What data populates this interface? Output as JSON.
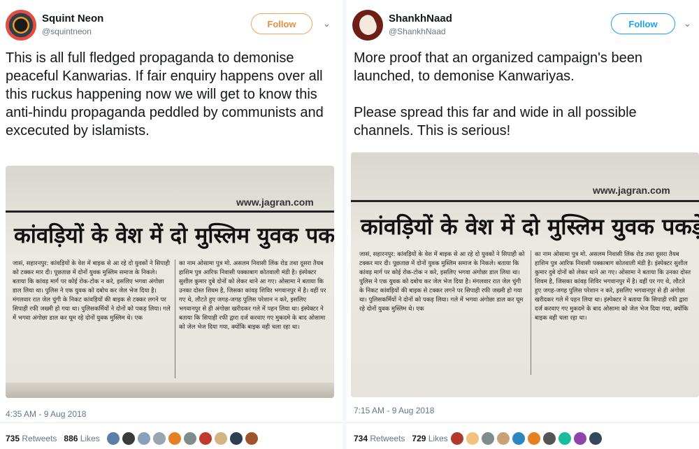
{
  "tweets": [
    {
      "name": "Squint Neon",
      "handle": "@squintneon",
      "follow_label": "Follow",
      "chevron": "⌄",
      "text": "This is all full fledged propaganda to demonise peaceful Kanwarias. If fair enquiry happens over all this ruckus happening now we will get to know this anti-hindu propaganda peddled by communists and excecuted by islamists.",
      "accent": "#f08a3c",
      "image": {
        "url": "www.jagran.com",
        "headline": "कांवड़ियों के वेश में दो मुस्लिम युवक पकड़े",
        "col1": "जासं, सहारनपुर: कांवड़ियों के वेश में बाइक से आ रहे दो युवकों ने सिपाही को टक्कर मार दी। पूछताछ में दोनों युवक मुस्लिम समाज के निकले। बताया कि कांवड़ मार्ग पर कोई रोक-टोक न करे, इसलिए भगवा अंगोछा डाल लिया था। पुलिस ने एक युवक को दबोच कर जेल भेज दिया है। मंगलवार रात जेल चुंगी के निकट कांवड़ियों की बाइक से टक्कर लगने पर सिपाही रफी जख्मी हो गया था। पुलिसकर्मियों ने दोनों को पकड़ लिया। गले में भगवा अंगोछा डाल कर घूम रहे दोनों युवक मुस्लिम थे। एक",
        "col2": "का नाम ओसामा पुत्र मो. असलम निवासी लिंक रोड तथा दूसरा तैयब हाशिम पुत्र आरिफ निवासी पक्काबाग कोतवाली मंडी है। इंस्पेक्टर सुशील कुमार दुबे दोनों को लेकर थाने आ गए। ओसामा ने बताया कि उनका दोस्त शिवम है, जिसका कांवड़ शिविर भगवानपुर में है। वहीं पर गए थे, लौटते हुए जगह-जगह पुलिस परेशान न करे, इसलिए भगवानपुर से ही अंगोछा खरीदकर गले में पहन लिया था। इंस्पेक्टर ने बताया कि सिपाही रफी द्वारा दर्ज करवाए गए मुकदमे के बाद ओसामा को जेल भेज दिया गया, क्योंकि बाइक वही चला रहा था।"
      },
      "timestamp": "4:35 AM - 9 Aug 2018",
      "retweets_count": "735",
      "retweets_label": "Retweets",
      "likes_count": "886",
      "likes_label": "Likes",
      "likers": [
        "#5b7fa6",
        "#3a3a3a",
        "#8aa0b8",
        "#9aa5b1",
        "#e67e22",
        "#7f8c8d",
        "#c0392b",
        "#d4b483",
        "#2c3e50",
        "#a0522d"
      ]
    },
    {
      "name": "ShankhNaad",
      "handle": "@ShankhNaad",
      "follow_label": "Follow",
      "chevron": "⌄",
      "text": "More proof that an organized campaign's been launched, to demonise Kanwariyas.\n\nPlease spread this far and wide in all possible channels. This is serious!",
      "accent": "#1da1f2",
      "image": {
        "url": "www.jagran.com",
        "headline": "कांवड़ियों के वेश में दो मुस्लिम युवक पकड़े",
        "col1": "जासं, सहारनपुर: कांवड़ियों के वेश में बाइक से आ रहे दो युवकों ने सिपाही को टक्कर मार दी। पूछताछ में दोनों युवक मुस्लिम समाज के निकले। बताया कि कांवड़ मार्ग पर कोई रोक-टोक न करे, इसलिए भगवा अंगोछा डाल लिया था। पुलिस ने एक युवक को दबोच कर जेल भेज दिया है। मंगलवार रात जेल चुंगी के निकट कांवड़ियों की बाइक से टक्कर लगने पर सिपाही रफी जख्मी हो गया था। पुलिसकर्मियों ने दोनों को पकड़ लिया। गले में भगवा अंगोछा डाल कर घूम रहे दोनों युवक मुस्लिम थे। एक",
        "col2": "का नाम ओसामा पुत्र मो. असलम निवासी लिंक रोड तथा दूसरा तैयब हाशिम पुत्र आरिफ निवासी पक्काबाग कोतवाली मंडी है। इंस्पेक्टर सुशील कुमार दुबे दोनों को लेकर थाने आ गए। ओसामा ने बताया कि उनका दोस्त शिवम है, जिसका कांवड़ शिविर भगवानपुर में है। वहीं पर गए थे, लौटते हुए जगह-जगह पुलिस परेशान न करे, इसलिए भगवानपुर से ही अंगोछा खरीदकर गले में पहन लिया था। इंस्पेक्टर ने बताया कि सिपाही रफी द्वारा दर्ज करवाए गए मुकदमे के बाद ओसामा को जेल भेज दिया गया, क्योंकि बाइक वही चला रहा था।"
      },
      "timestamp": "7:15 AM - 9 Aug 2018",
      "retweets_count": "734",
      "retweets_label": "Retweets",
      "likes_count": "729",
      "likes_label": "Likes",
      "likers": [
        "#b03a2e",
        "#f0c27b",
        "#7f8c8d",
        "#c8a27a",
        "#2e86c1",
        "#e67e22",
        "#555555",
        "#1abc9c",
        "#8e44ad",
        "#34495e"
      ]
    }
  ]
}
